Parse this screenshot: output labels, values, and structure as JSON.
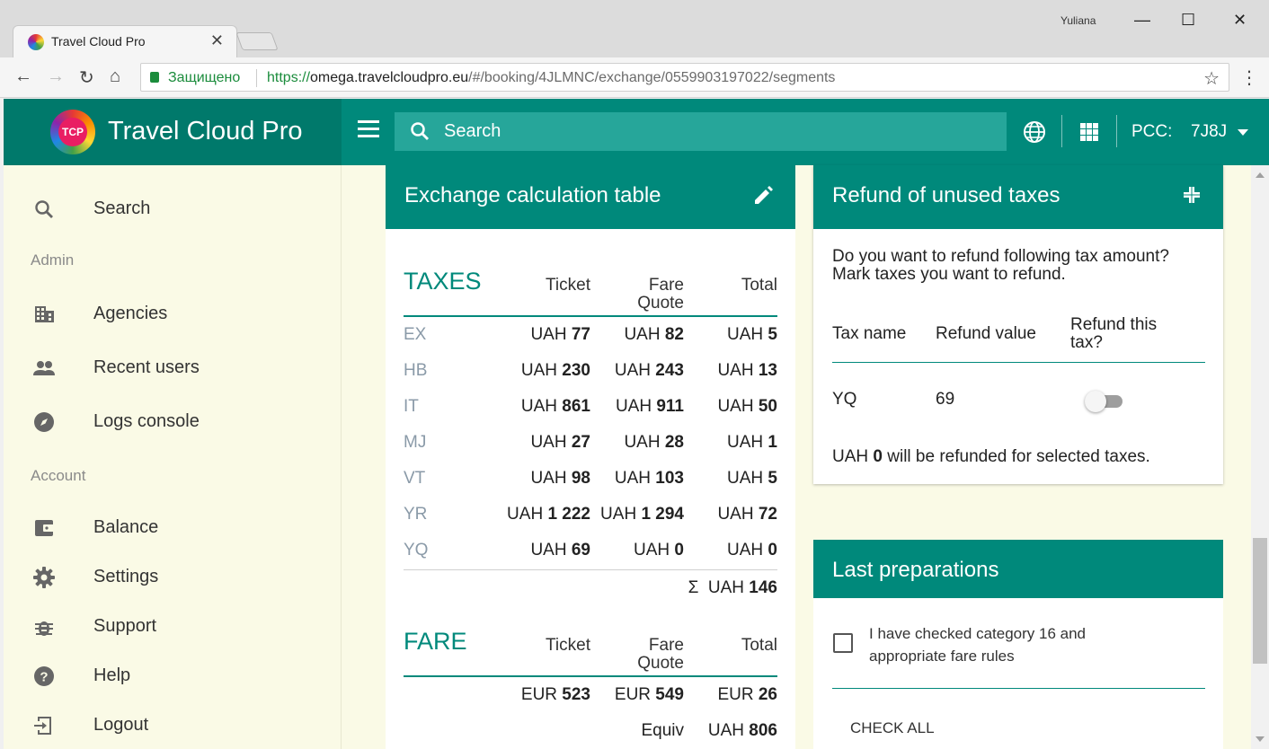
{
  "browser": {
    "tab_title": "Travel Cloud Pro",
    "tab_close": "✕",
    "user": "Yuliana",
    "secure_label": "Защищено",
    "url_scheme": "https://",
    "url_domain": "omega.travelcloudpro.eu",
    "url_path": "/#/booking/4JLMNC/exchange/0559903197022/segments",
    "minimize": "—",
    "maximize": "☐",
    "close": "✕"
  },
  "header": {
    "brand": "Travel Cloud Pro",
    "logo_text": "TCP",
    "search_placeholder": "Search",
    "pcc_label": "PCC:",
    "pcc_value": "7J8J"
  },
  "sidebar": {
    "search": "Search",
    "admin_section": "Admin",
    "agencies": "Agencies",
    "recent_users": "Recent users",
    "logs_console": "Logs console",
    "account_section": "Account",
    "balance": "Balance",
    "settings": "Settings",
    "support": "Support",
    "help": "Help",
    "logout": "Logout"
  },
  "exchange": {
    "title": "Exchange calculation table",
    "taxes_title": "TAXES",
    "col_ticket": "Ticket",
    "col_fare_quote_1": "Fare",
    "col_fare_quote_2": "Quote",
    "col_total": "Total",
    "currency_uah": "UAH",
    "taxes": [
      {
        "code": "EX",
        "ticket": "77",
        "fare_quote": "82",
        "total": "5"
      },
      {
        "code": "HB",
        "ticket": "230",
        "fare_quote": "243",
        "total": "13"
      },
      {
        "code": "IT",
        "ticket": "861",
        "fare_quote": "911",
        "total": "50"
      },
      {
        "code": "MJ",
        "ticket": "27",
        "fare_quote": "28",
        "total": "1"
      },
      {
        "code": "VT",
        "ticket": "98",
        "fare_quote": "103",
        "total": "5"
      },
      {
        "code": "YR",
        "ticket": "1 222",
        "fare_quote": "1 294",
        "total": "72"
      },
      {
        "code": "YQ",
        "ticket": "69",
        "fare_quote": "0",
        "total": "0"
      }
    ],
    "sum_symbol": "Σ",
    "sum_currency": "UAH",
    "sum_value": "146",
    "fare_title": "FARE",
    "fare_currency": "EUR",
    "fare_ticket": "523",
    "fare_quote": "549",
    "fare_total": "26",
    "equiv_label": "Equiv",
    "equiv_currency": "UAH",
    "equiv_value": "806"
  },
  "refund": {
    "title": "Refund of unused taxes",
    "question": "Do you want to refund following tax amount? Mark taxes you want to refund.",
    "col_tax_name": "Tax name",
    "col_refund_value": "Refund value",
    "col_refund_this_1": "Refund this",
    "col_refund_this_2": "tax?",
    "row_tax": "YQ",
    "row_value": "69",
    "row_refund_checked": false,
    "summary_currency": "UAH",
    "summary_amount": "0",
    "summary_text": "will be refunded for selected taxes."
  },
  "last_preparations": {
    "title": "Last preparations",
    "checkbox_label": "I have checked category 16 and appropriate fare rules",
    "checkbox_checked": false,
    "check_all": "CHECK ALL"
  },
  "colors": {
    "primary": "#00897b",
    "primary_dark": "#00796b",
    "sidebar_bg": "#fafae6"
  }
}
